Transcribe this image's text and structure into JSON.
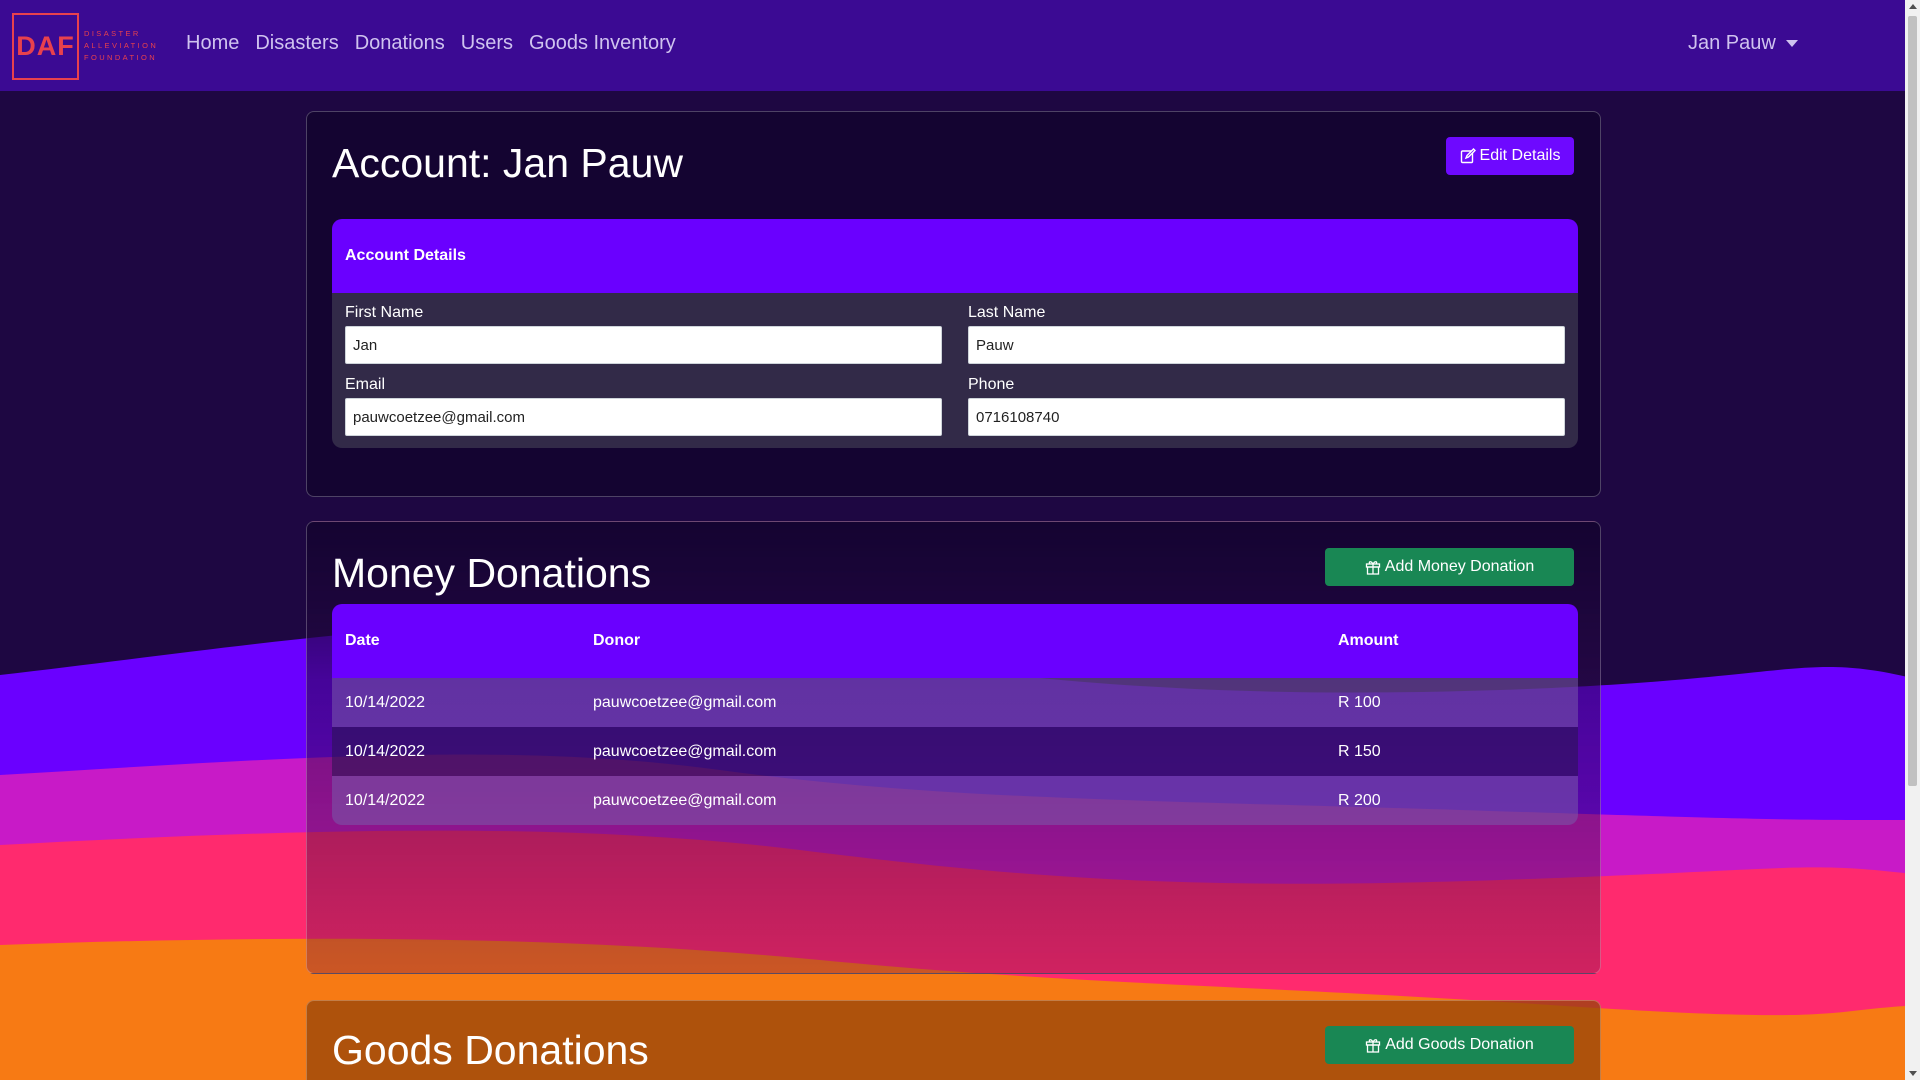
{
  "brand": {
    "logo_letters": "DAF",
    "logo_words": [
      "DISASTER",
      "ALLEVIATION",
      "FOUNDATION"
    ],
    "color": "#e8414d"
  },
  "nav": {
    "links": [
      "Home",
      "Disasters",
      "Donations",
      "Users",
      "Goods Inventory"
    ],
    "user": "Jan Pauw"
  },
  "account": {
    "title": "Account: Jan Pauw",
    "edit_button": "Edit Details",
    "panel_title": "Account Details",
    "first_name_label": "First Name",
    "first_name": "Jan",
    "last_name_label": "Last Name",
    "last_name": "Pauw",
    "email_label": "Email",
    "email": "pauwcoetzee@gmail.com",
    "phone_label": "Phone",
    "phone": "0716108740"
  },
  "money": {
    "title": "Money Donations",
    "add_button": "Add Money Donation",
    "columns": [
      "Date",
      "Donor",
      "Amount"
    ],
    "rows": [
      {
        "date": "10/14/2022",
        "donor": "pauwcoetzee@gmail.com",
        "amount": "R 100"
      },
      {
        "date": "10/14/2022",
        "donor": "pauwcoetzee@gmail.com",
        "amount": "R 150"
      },
      {
        "date": "10/14/2022",
        "donor": "pauwcoetzee@gmail.com",
        "amount": "R 200"
      }
    ]
  },
  "goods": {
    "title": "Goods Donations",
    "add_button": "Add Goods Donation"
  },
  "colors": {
    "nav_bg": "#3b0a93",
    "accent": "#6a00ff",
    "success": "#198754"
  },
  "icons": {
    "edit": "edit-icon",
    "gift": "gift-icon"
  }
}
